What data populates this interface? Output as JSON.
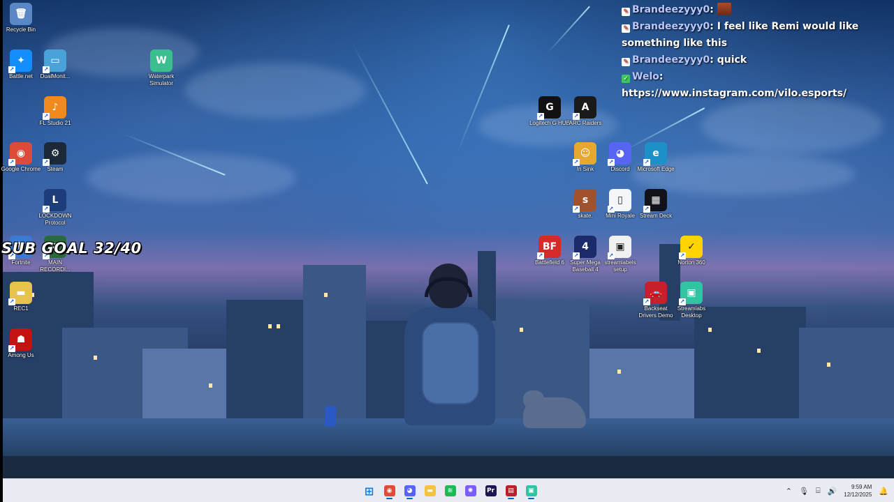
{
  "desktop_icons": [
    {
      "id": "recycle-bin",
      "label": "Recycle Bin",
      "glyph": "🗑",
      "color": "#5a87c5",
      "shortcut": false
    },
    {
      "id": "battlenet",
      "label": "Battle.net",
      "glyph": "✦",
      "color": "#148eff",
      "shortcut": true
    },
    {
      "id": "dualmonitor",
      "label": "DualMonit...",
      "glyph": "▭",
      "color": "#4aa3d8",
      "shortcut": true
    },
    {
      "id": "waterpark",
      "label": "Waterpark Simulator",
      "glyph": "W",
      "color": "#3bbf8f",
      "shortcut": false
    },
    {
      "id": "flstudio",
      "label": "FL Studio 21",
      "glyph": "♪",
      "color": "#f08a1c",
      "shortcut": true
    },
    {
      "id": "chrome",
      "label": "Google Chrome",
      "glyph": "◉",
      "color": "#dd4b39",
      "shortcut": true
    },
    {
      "id": "steam",
      "label": "Steam",
      "glyph": "⚙",
      "color": "#1b2838",
      "shortcut": true
    },
    {
      "id": "lockdown",
      "label": "LOCKDOWN Protocol",
      "glyph": "L",
      "color": "#1d3c7a",
      "shortcut": true
    },
    {
      "id": "fortnite",
      "label": "Fortnite",
      "glyph": "F",
      "color": "#3a7bd5",
      "shortcut": true
    },
    {
      "id": "main-recording",
      "label": "MAIN RECORDI...",
      "glyph": "●",
      "color": "#2a6a3a",
      "shortcut": true
    },
    {
      "id": "rec1",
      "label": "REC1",
      "glyph": "▬",
      "color": "#e6c34a",
      "shortcut": true
    },
    {
      "id": "among-us",
      "label": "Among Us",
      "glyph": "☗",
      "color": "#c51111",
      "shortcut": true
    },
    {
      "id": "logitech",
      "label": "Logitech G HUB",
      "glyph": "G",
      "color": "#111111",
      "shortcut": true
    },
    {
      "id": "arc-raiders",
      "label": "ARC Raiders",
      "glyph": "A",
      "color": "#1a1a1a",
      "shortcut": true
    },
    {
      "id": "in-sink",
      "label": "In Sink",
      "glyph": "☺",
      "color": "#e8a830",
      "shortcut": true
    },
    {
      "id": "discord",
      "label": "Discord",
      "glyph": "◕",
      "color": "#5865f2",
      "shortcut": true
    },
    {
      "id": "edge",
      "label": "Microsoft Edge",
      "glyph": "e",
      "color": "#1e90c8",
      "shortcut": true
    },
    {
      "id": "skate",
      "label": "skate.",
      "glyph": "s",
      "color": "#a0522d",
      "shortcut": true
    },
    {
      "id": "mini-royale",
      "label": "Mini Royale",
      "glyph": "▯",
      "color": "#f4f6fa",
      "shortcut": true
    },
    {
      "id": "stream-deck",
      "label": "Stream Deck",
      "glyph": "▦",
      "color": "#12121a",
      "shortcut": true
    },
    {
      "id": "battlefield6",
      "label": "Battlefield 6",
      "glyph": "BF",
      "color": "#d42a2a",
      "shortcut": true
    },
    {
      "id": "smb4",
      "label": "Super Mega Baseball 4",
      "glyph": "4",
      "color": "#1a2a6a",
      "shortcut": true
    },
    {
      "id": "streamlabels",
      "label": "streamlabels setup",
      "glyph": "▣",
      "color": "#f1f1f1",
      "shortcut": true
    },
    {
      "id": "norton",
      "label": "Norton 360",
      "glyph": "✓",
      "color": "#ffd400",
      "shortcut": true
    },
    {
      "id": "backseat",
      "label": "Backseat Drivers Demo",
      "glyph": "🚗",
      "color": "#c8202a",
      "shortcut": true
    },
    {
      "id": "streamlabs",
      "label": "Streamlabs Desktop",
      "glyph": "▣",
      "color": "#31c3a2",
      "shortcut": true
    }
  ],
  "chat": [
    {
      "badge": "red",
      "user": "Brandeezyyy0",
      "text": "",
      "emote": true
    },
    {
      "badge": "red",
      "user": "Brandeezyyy0",
      "text": " I feel like Remi would like something like this",
      "emote": false
    },
    {
      "badge": "red",
      "user": "Brandeezyyy0",
      "text": " quick",
      "emote": false
    },
    {
      "badge": "green",
      "user": "Welo",
      "text": "",
      "emote": false
    },
    {
      "badge": "",
      "user": "",
      "text": "https://www.instagram.com/vilo.esports/",
      "emote": false
    }
  ],
  "overlay": {
    "sub_goal": "SUB GOAL 32/40"
  },
  "taskbar": {
    "apps": [
      {
        "id": "start",
        "glyph": "⊞",
        "color": "#0a7ae0",
        "active": false
      },
      {
        "id": "chrome",
        "glyph": "◉",
        "color": "#dd4b39",
        "active": true
      },
      {
        "id": "discord",
        "glyph": "◕",
        "color": "#5865f2",
        "active": true
      },
      {
        "id": "explorer",
        "glyph": "▬",
        "color": "#f5c341",
        "active": false
      },
      {
        "id": "spotify",
        "glyph": "≋",
        "color": "#1db954",
        "active": false
      },
      {
        "id": "copilot",
        "glyph": "✺",
        "color": "#7a5cff",
        "active": false
      },
      {
        "id": "premiere",
        "glyph": "Pr",
        "color": "#1e1450",
        "active": false
      },
      {
        "id": "obs-overlay",
        "glyph": "▤",
        "color": "#b8202a",
        "active": true
      },
      {
        "id": "streamlabs",
        "glyph": "▣",
        "color": "#31c3a2",
        "active": true
      }
    ],
    "time": "9:59 AM",
    "date": "12/12/2025"
  }
}
